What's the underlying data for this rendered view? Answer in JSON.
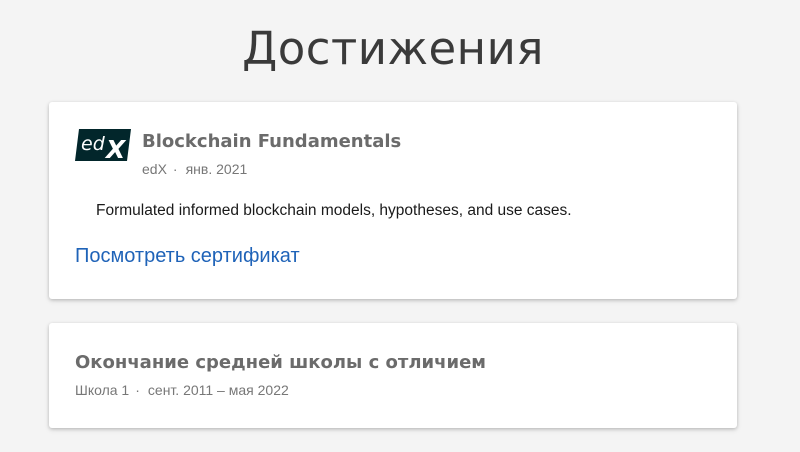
{
  "page": {
    "title": "Достижения"
  },
  "certificate": {
    "title": "Blockchain Fundamentals",
    "issuer": "edX",
    "separator": "·",
    "date": "янв. 2021",
    "description": "Formulated informed blockchain models, hypotheses, and use cases.",
    "link_label": "Посмотреть сертификат",
    "logo": {
      "icon": "edx-logo-icon",
      "text_ed": "ed",
      "text_x": "X",
      "color": "#02262b"
    }
  },
  "education": {
    "title": "Окончание средней школы с отличием",
    "school": "Школа 1",
    "separator": "·",
    "dates": "сент. 2011 – мая 2022"
  },
  "colors": {
    "background": "#f4f4f4",
    "card": "#ffffff",
    "link": "#1f63b8",
    "heading": "#3a3a3a",
    "card_title": "#6b6b6b",
    "meta": "#777777"
  }
}
